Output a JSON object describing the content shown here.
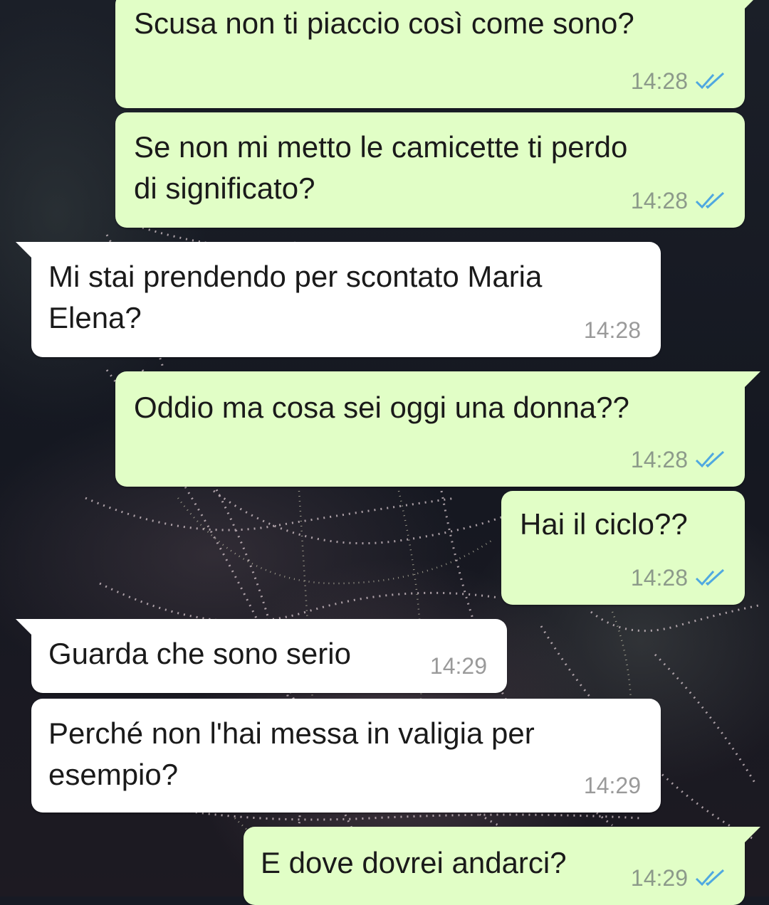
{
  "colors": {
    "outgoing_bubble": "#e1fec6",
    "incoming_bubble": "#ffffff",
    "read_ticks": "#4fa8e0",
    "timestamp": "#9a9a9a"
  },
  "messages": [
    {
      "direction": "outgoing",
      "text": "Scusa non ti piaccio così come sono?",
      "time": "14:28",
      "status_icon": "double-check-read-icon"
    },
    {
      "direction": "outgoing",
      "text": "Se non mi metto le camicette ti perdo\ndi significato?",
      "time": "14:28",
      "status_icon": "double-check-read-icon"
    },
    {
      "direction": "incoming",
      "text": "Mi stai prendendo per scontato Maria\nElena?",
      "time": "14:28"
    },
    {
      "direction": "outgoing",
      "text": "Oddio ma cosa sei oggi una donna??",
      "time": "14:28",
      "status_icon": "double-check-read-icon"
    },
    {
      "direction": "outgoing",
      "text": "Hai il ciclo??",
      "time": "14:28",
      "status_icon": "double-check-read-icon"
    },
    {
      "direction": "incoming",
      "text": "Guarda che sono serio",
      "time": "14:29"
    },
    {
      "direction": "incoming",
      "text": "Perché non l'hai messa in valigia per\nesempio?",
      "time": "14:29"
    },
    {
      "direction": "outgoing",
      "text": "E dove dovrei andarci?",
      "time": "14:29",
      "status_icon": "double-check-read-icon"
    }
  ]
}
